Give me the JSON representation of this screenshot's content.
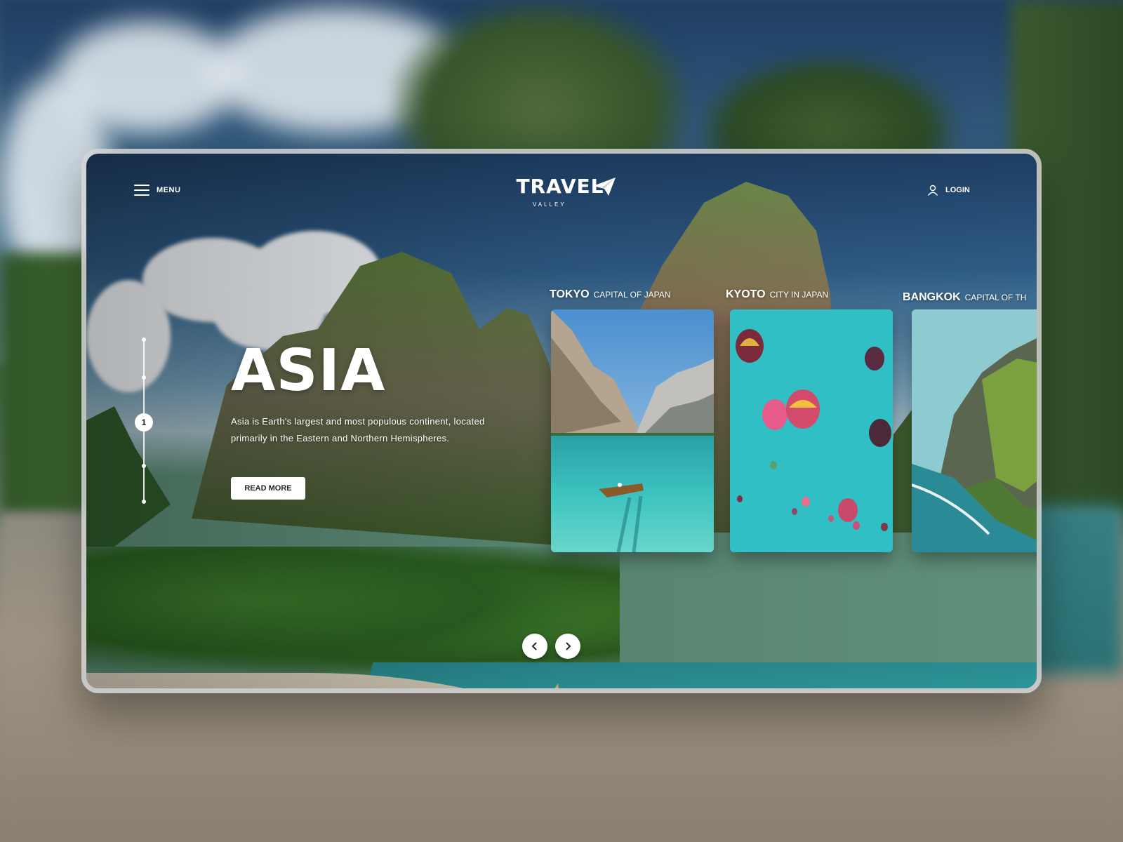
{
  "header": {
    "menu_label": "MENU",
    "logo_main": "TRAVEL",
    "logo_sub": "VALLEY",
    "login_label": "LOGIN"
  },
  "pager": {
    "active_page": "1"
  },
  "hero": {
    "title": "ASIA",
    "description": "Asia is Earth's largest and most populous continent, located primarily in the Eastern and Northern Hemispheres.",
    "button_label": "READ MORE"
  },
  "cards": [
    {
      "city": "TOKYO",
      "subtitle": "CAPITAL OF JAPAN"
    },
    {
      "city": "KYOTO",
      "subtitle": "CITY IN JAPAN"
    },
    {
      "city": "BANGKOK",
      "subtitle": "CAPITAL OF TH"
    }
  ],
  "navigation": {
    "prev_icon": "chevron-left-icon",
    "next_icon": "chevron-right-icon"
  },
  "colors": {
    "accent_white": "#ffffff",
    "sea": "#2fa3a3",
    "sky": "#2f5c86"
  }
}
